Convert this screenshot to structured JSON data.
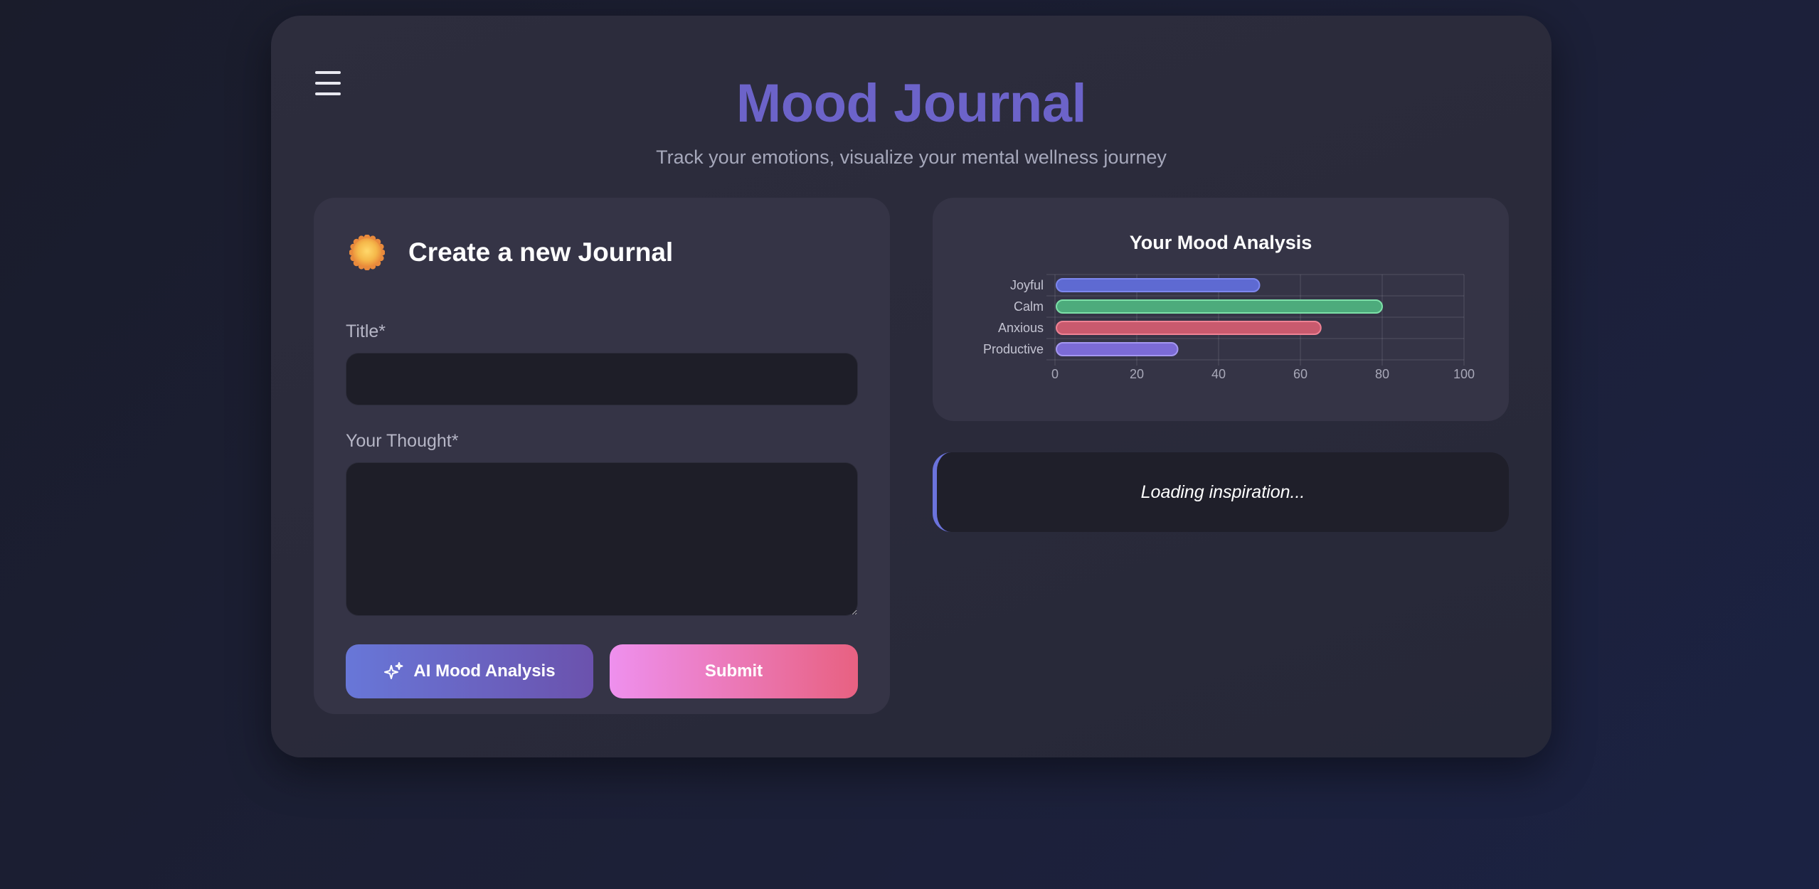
{
  "header": {
    "menu_icon": "hamburger-menu-icon",
    "title": "Mood Journal",
    "subtitle": "Track your emotions, visualize your mental wellness journey"
  },
  "journal_form": {
    "icon": "sun-icon",
    "heading": "Create a new Journal",
    "title_label": "Title*",
    "title_value": "",
    "thought_label": "Your Thought*",
    "thought_value": "",
    "ai_button_label": "AI Mood Analysis",
    "ai_button_icon": "sparkle-icon",
    "submit_label": "Submit"
  },
  "quote": {
    "text": "Loading inspiration..."
  },
  "colors": {
    "accent": "#6c63c9",
    "joyful": "#5e6ad2",
    "calm": "#4dab7c",
    "anxious": "#c95a6e",
    "productive": "#7c6bd6"
  },
  "chart_data": {
    "type": "bar",
    "orientation": "horizontal",
    "title": "Your Mood Analysis",
    "categories": [
      "Joyful",
      "Calm",
      "Anxious",
      "Productive"
    ],
    "values": [
      50,
      80,
      65,
      30
    ],
    "colors": [
      "#5e6ad2",
      "#4dab7c",
      "#c95a6e",
      "#7c6bd6"
    ],
    "border_colors": [
      "#7d87ee",
      "#7de0a8",
      "#ee8294",
      "#a497f0"
    ],
    "xlim": [
      0,
      100
    ],
    "xticks": [
      "0",
      "20",
      "40",
      "60",
      "80",
      "100"
    ],
    "grid": true,
    "legend": "none"
  }
}
